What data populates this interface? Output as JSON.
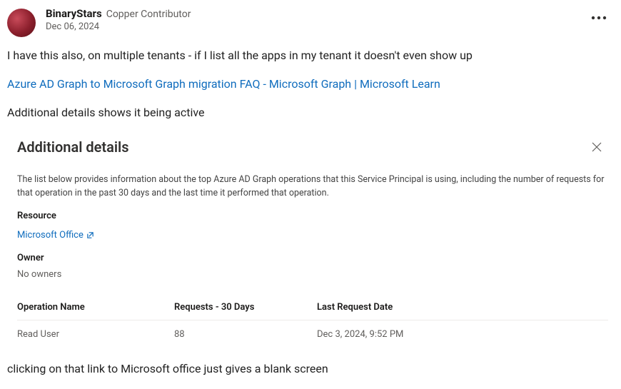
{
  "post": {
    "author": "BinaryStars",
    "role": "Copper Contributor",
    "date": "Dec 06, 2024",
    "p1": "I have this also, on multiple tenants - if I list all the apps in my tenant it doesn't even show up",
    "link_text": "Azure AD Graph to Microsoft Graph migration FAQ - Microsoft Graph | Microsoft Learn",
    "p2": "Additional details shows it being active",
    "p3": "clicking on that link to Microsoft office just gives a blank screen"
  },
  "panel": {
    "title": "Additional details",
    "description": "The list below provides information about the top Azure AD Graph operations that this Service Principal is using, including the number of requests for that operation in the past 30 days and the last time it performed that operation.",
    "resource_label": "Resource",
    "resource_value": "Microsoft Office",
    "owner_label": "Owner",
    "owner_value": "No owners",
    "cols": {
      "op": "Operation Name",
      "req": "Requests - 30 Days",
      "last": "Last Request Date"
    },
    "row": {
      "op": "Read User",
      "req": "88",
      "last": "Dec 3, 2024, 9:52 PM"
    }
  }
}
